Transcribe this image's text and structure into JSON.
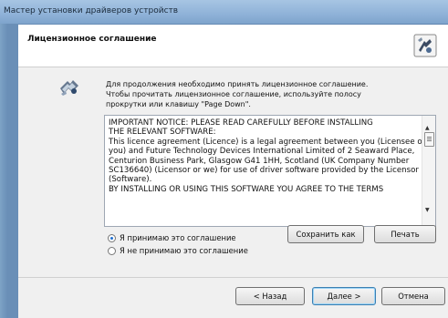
{
  "window": {
    "title": "Мастер установки драйверов устройств"
  },
  "header": {
    "title": "Лицензионное соглашение"
  },
  "intro": {
    "lines": [
      "Для продолжения необходимо принять лицензионное соглашение.",
      "Чтобы прочитать лицензионное соглашение, используйте полосу",
      "прокрутки или клавишу \"Page Down\"."
    ]
  },
  "license": {
    "lines": [
      "IMPORTANT NOTICE: PLEASE READ CAREFULLY BEFORE INSTALLING",
      "THE RELEVANT SOFTWARE:",
      "This licence agreement (Licence) is a legal agreement between you (Licensee or",
      "you) and Future Technology Devices International Limited of 2 Seaward Place,",
      "Centurion Business Park, Glasgow G41 1HH, Scotland (UK Company Number",
      "SC136640) (Licensor or we) for use of driver software provided by the Licensor",
      "(Software).",
      "",
      "BY INSTALLING OR USING THIS SOFTWARE YOU AGREE TO THE TERMS"
    ]
  },
  "options": {
    "accept": "Я принимаю это соглашение",
    "decline": "Я не принимаю это соглашение",
    "selected": "accept"
  },
  "buttons": {
    "save": "Сохранить как",
    "print": "Печать",
    "back": "< Назад",
    "next": "Далее >",
    "cancel": "Отмена"
  }
}
